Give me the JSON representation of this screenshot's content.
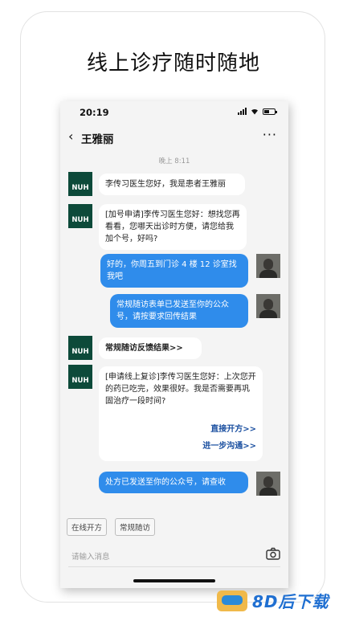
{
  "headline": "线上诊疗随时随地",
  "status": {
    "time": "20:19"
  },
  "nav": {
    "back_icon": "‹",
    "title": "王雅丽",
    "more": "···"
  },
  "timestamp": "晚上 8:11",
  "avatar_label": "NUH",
  "messages": [
    {
      "side": "in",
      "text": "李传习医生您好，我是患者王雅丽"
    },
    {
      "side": "in",
      "text": "[加号申请]李传习医生您好：想找您再看看，您哪天出诊时方便，请您给我加个号，好吗?"
    },
    {
      "side": "out",
      "text": "好的，你周五到门诊 4 楼 12 诊室找我吧"
    },
    {
      "side": "out",
      "text": "常规随访表单已发送至你的公众号，请按要求回传结果"
    },
    {
      "side": "in",
      "text": "常规随访反馈结果>>"
    },
    {
      "side": "in",
      "text": "[申请线上复诊]李传习医生您好：上次您开的药已吃完，效果很好。我是否需要再巩固治疗一段时间?",
      "link1": "直接开方>>",
      "link2": "进一步沟通>>"
    },
    {
      "side": "out",
      "text": "处方已发送至你的公众号，请查收"
    }
  ],
  "chips": [
    "在线开方",
    "常规随访"
  ],
  "input": {
    "placeholder": "请输入消息"
  },
  "watermark": "8D后下载",
  "colors": {
    "outgoing_bubble": "#2f8ceb",
    "nuh_avatar": "#0d4a3a",
    "link": "#1a4fa0"
  }
}
